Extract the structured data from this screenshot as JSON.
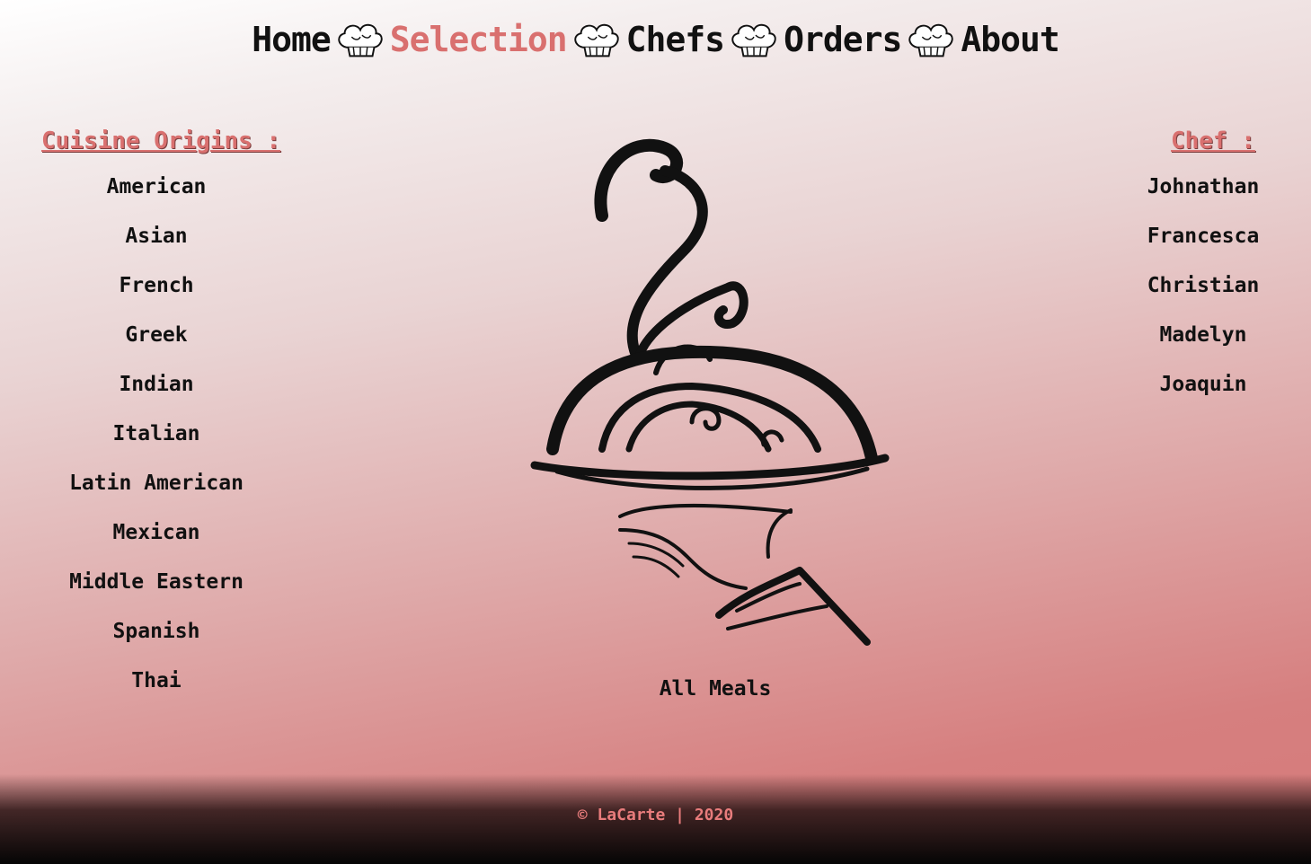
{
  "nav": {
    "items": [
      {
        "label": "Home"
      },
      {
        "label": "Selection"
      },
      {
        "label": "Chefs"
      },
      {
        "label": "Orders"
      },
      {
        "label": "About"
      }
    ],
    "active": "Selection",
    "separator_icon": "chef-hat-icon"
  },
  "cuisine": {
    "title": "Cuisine Origins :",
    "items": [
      "American",
      "Asian",
      "French",
      "Greek",
      "Indian",
      "Italian",
      "Latin American",
      "Mexican",
      "Middle Eastern",
      "Spanish",
      "Thai"
    ]
  },
  "chef": {
    "title": "Chef :",
    "items": [
      "Johnathan",
      "Francesca",
      "Christian",
      "Madelyn",
      "Joaquin"
    ]
  },
  "center": {
    "logo_icon": "serving-cloche-hand-icon",
    "all_meals_label": "All Meals"
  },
  "footer": {
    "text": "© LaCarte | 2020"
  },
  "colors": {
    "accent": "#d9706f",
    "text": "#111111",
    "footer_bg": "#050505"
  }
}
